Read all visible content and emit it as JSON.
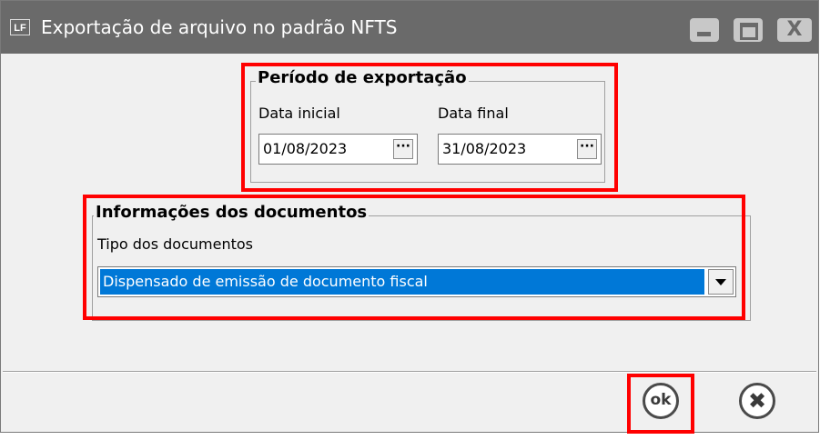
{
  "window": {
    "icon_text": "LF",
    "title": "Exportação de arquivo no padrão NFTS",
    "close_glyph": "X"
  },
  "periodo": {
    "title": "Período de exportação",
    "data_inicial_label": "Data inicial",
    "data_inicial_value": "01/08/2023",
    "data_final_label": "Data final",
    "data_final_value": "31/08/2023",
    "ellipsis": "···"
  },
  "documentos": {
    "title": "Informações dos documentos",
    "tipo_label": "Tipo dos documentos",
    "tipo_value": "Dispensado de emissão de documento fiscal"
  },
  "footer": {
    "ok_label": "ok",
    "cancel_glyph": "✖"
  },
  "colors": {
    "titlebar": "#6a6a6a",
    "selection": "#0078d7",
    "highlight": "#ff0000"
  }
}
